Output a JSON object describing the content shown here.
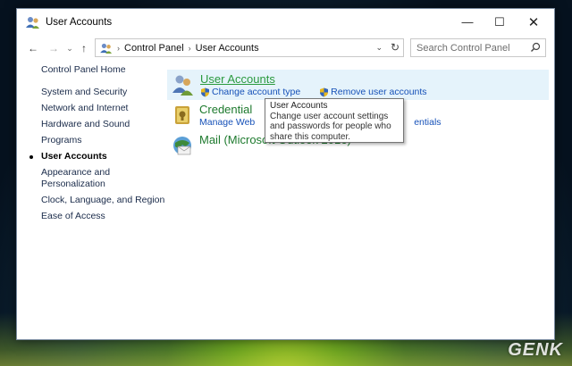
{
  "window": {
    "title": "User Accounts",
    "minimize": "—",
    "maximize": "☐",
    "close": "✕"
  },
  "nav": {
    "back": "←",
    "forward": "→",
    "recent": "⌄",
    "up": "↑"
  },
  "address": {
    "crumbs": [
      "Control Panel",
      "User Accounts"
    ],
    "separator": "›",
    "dropdown": "⌄",
    "refresh": "↻"
  },
  "search": {
    "placeholder": "Search Control Panel"
  },
  "sidebar": {
    "items": [
      {
        "label": "Control Panel Home"
      },
      {
        "label": "System and Security"
      },
      {
        "label": "Network and Internet"
      },
      {
        "label": "Hardware and Sound"
      },
      {
        "label": "Programs"
      },
      {
        "label": "User Accounts",
        "current": true
      },
      {
        "label": "Appearance and"
      },
      {
        "label": "Personalization"
      },
      {
        "label": "Clock, Language, and Region"
      },
      {
        "label": "Ease of Access"
      }
    ]
  },
  "main": {
    "user_accounts": {
      "title": "User Accounts",
      "link1": "Change account type",
      "link2": "Remove user accounts"
    },
    "credential": {
      "title": "Credential",
      "link1_start": "Manage Web",
      "link1_end": "entials"
    },
    "mail": {
      "title": "Mail (Microsoft Outlook 2016)"
    }
  },
  "tooltip": {
    "title": "User Accounts",
    "body": "Change user account settings and passwords for people who share this computer."
  },
  "watermark": "GENK",
  "colors": {
    "category_green": "#1e7a2e",
    "link_blue": "#1651b8",
    "hover_bg": "#e5f3fb"
  }
}
